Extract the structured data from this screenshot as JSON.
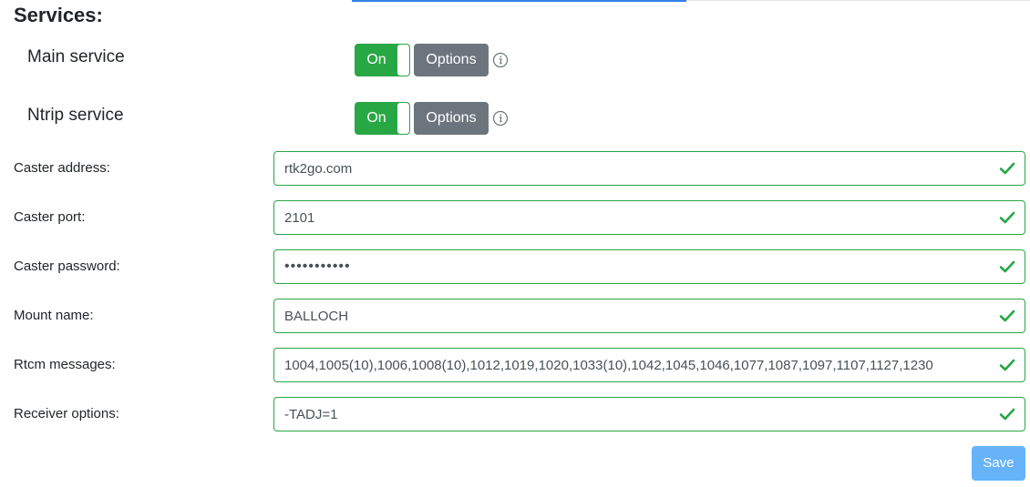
{
  "section": {
    "title": "Services:"
  },
  "services": [
    {
      "label": "Main service",
      "toggle": "On",
      "options": "Options"
    },
    {
      "label": "Ntrip service",
      "toggle": "On",
      "options": "Options"
    }
  ],
  "fields": [
    {
      "label": "Caster address:",
      "value": "rtk2go.com"
    },
    {
      "label": "Caster port:",
      "value": "2101"
    },
    {
      "label": "Caster password:",
      "value": "•••••••••••"
    },
    {
      "label": "Mount name:",
      "value": "BALLOCH"
    },
    {
      "label": "Rtcm messages:",
      "value": "1004,1005(10),1006,1008(10),1012,1019,1020,1033(10),1042,1045,1046,1077,1087,1097,1107,1127,1230"
    },
    {
      "label": "Receiver options:",
      "value": "-TADJ=1"
    }
  ],
  "save": {
    "label": "Save"
  },
  "colors": {
    "success": "#28a745",
    "secondary": "#6c757d",
    "primary_disabled": "#66b3fa",
    "accent_rule": "#2f80ed"
  },
  "icons": {
    "info": "info-icon",
    "valid": "check-icon"
  }
}
